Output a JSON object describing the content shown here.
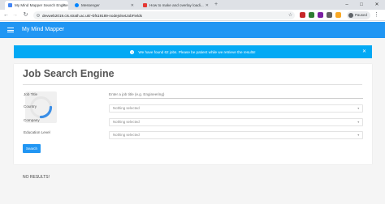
{
  "browser": {
    "tabs": [
      {
        "title": "My Mind Mapper Search Engine",
        "favicon_color": "#4285f4"
      },
      {
        "title": "Messenger",
        "favicon_color": "#0084ff"
      },
      {
        "title": "How to make and overlay loadi...",
        "favicon_color": "#e53935"
      }
    ],
    "new_tab": "+",
    "window_controls": [
      "–",
      "□",
      "✕"
    ],
    "url": "devweb2019.cis.strath.ac.uk/~bfs19189-nodejs/setJobFields",
    "profile_label": "Paused"
  },
  "app": {
    "title": "My Mind Mapper",
    "accent_color": "#2196f3"
  },
  "alert": {
    "message": "We have found 62 jobs. Please be patient while we retrieve the results!",
    "close": "✕"
  },
  "form": {
    "heading": "Job Search Engine",
    "labels": {
      "job_title": "Job Title",
      "country": "Country",
      "company": "Company",
      "education": "Education Level"
    },
    "job_title_placeholder": "Enter a job title (e.g. Engineering)",
    "select_placeholder": "Nothing selected",
    "search_button": "Search"
  },
  "results": {
    "message": "NO RESULTS!"
  }
}
